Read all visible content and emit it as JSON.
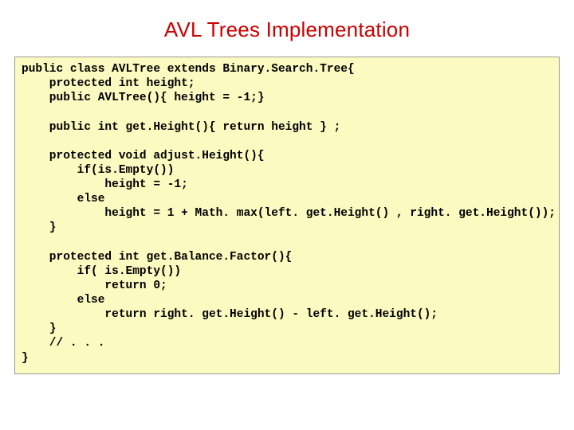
{
  "title": "AVL Trees Implementation",
  "code": "public class AVLTree extends Binary.Search.Tree{\n    protected int height;\n    public AVLTree(){ height = -1;}\n\n    public int get.Height(){ return height } ;\n\n    protected void adjust.Height(){\n        if(is.Empty())\n            height = -1;\n        else\n            height = 1 + Math. max(left. get.Height() , right. get.Height());\n    }\n\n    protected int get.Balance.Factor(){\n        if( is.Empty())\n            return 0;\n        else\n            return right. get.Height() - left. get.Height();\n    }\n    // . . .\n}"
}
